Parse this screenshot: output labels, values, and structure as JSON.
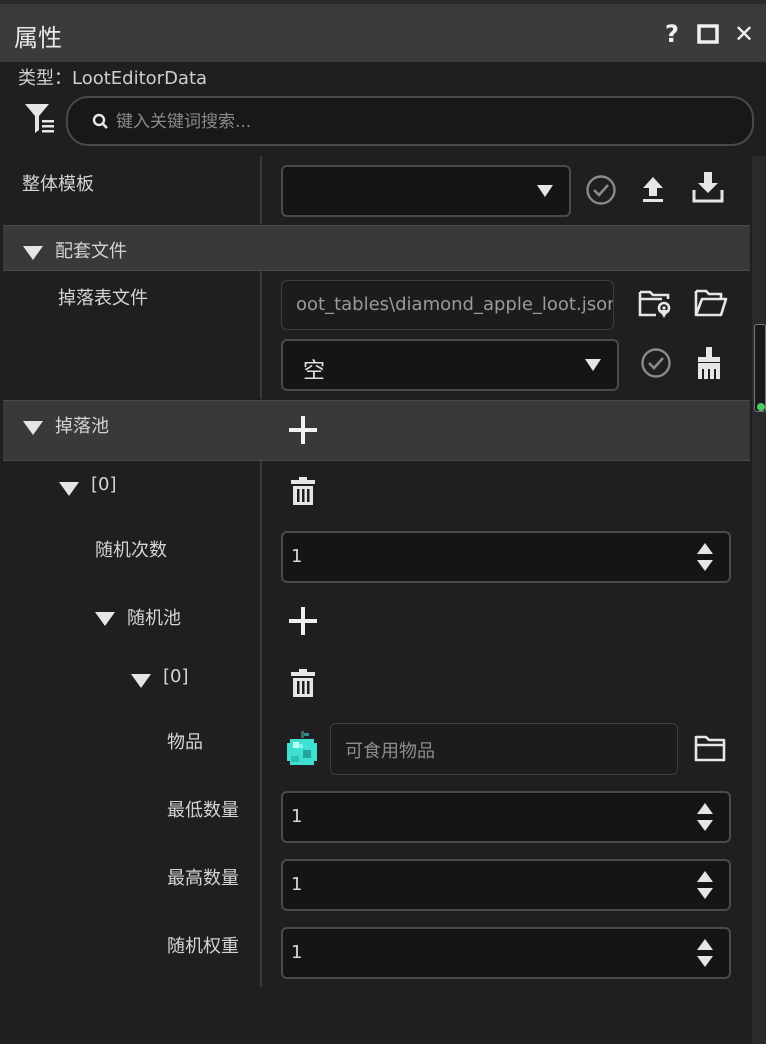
{
  "window": {
    "title": "属性",
    "help_label": "?",
    "close_label": "✕"
  },
  "type_line": "类型：LootEditorData",
  "search": {
    "placeholder": "键入关键词搜索..."
  },
  "rows": {
    "overall_template": {
      "label": "整体模板",
      "value": ""
    },
    "companion_section": {
      "label": "配套文件"
    },
    "loot_table_file": {
      "label": "掉落表文件",
      "path": "oot_tables\\diamond_apple_loot.json",
      "combo_value": "空"
    },
    "loot_pool_section": {
      "label": "掉落池"
    },
    "pool_index": {
      "label": "[0]"
    },
    "random_rolls": {
      "label": "随机次数",
      "value": "1"
    },
    "random_pool": {
      "label": "随机池"
    },
    "entry_index": {
      "label": "[0]"
    },
    "item": {
      "label": "物品",
      "placeholder": "可食用物品"
    },
    "min_count": {
      "label": "最低数量",
      "value": "1"
    },
    "max_count": {
      "label": "最高数量",
      "value": "1"
    },
    "random_weight": {
      "label": "随机权重",
      "value": "1"
    }
  },
  "icons": {
    "filter": "filter-icon",
    "search": "search-icon",
    "confirm": "check-circle-icon",
    "upload": "upload-icon",
    "download": "download-icon",
    "locate_folder": "folder-location-icon",
    "open_folder": "folder-open-icon",
    "clear": "broom-icon",
    "add": "plus-icon",
    "delete": "trash-icon",
    "item_preview": "diamond-apple-icon"
  },
  "colors": {
    "background": "#1f1f21",
    "section": "#38393b",
    "titlebar": "#3a3b3d",
    "scroll_indicator": "#4ccb63",
    "item_icon": "#3fe0d0"
  }
}
